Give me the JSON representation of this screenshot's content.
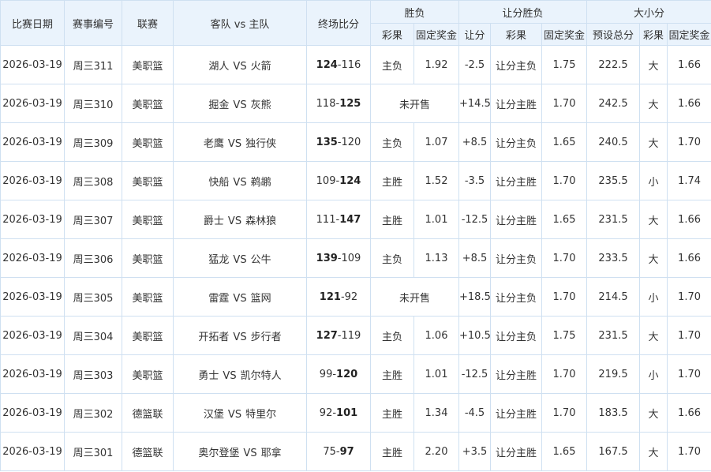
{
  "headers": {
    "date": "比赛日期",
    "match_no": "赛事编号",
    "league": "联赛",
    "teams": "客队 vs 主队",
    "final_score": "终场比分",
    "win_loss": "胜负",
    "handicap_win_loss": "让分胜负",
    "over_under": "大小分",
    "lottery_result": "彩果",
    "fixed_odds": "固定奖金",
    "handicap": "让分",
    "preset_total": "预设总分"
  },
  "vs_text": "VS",
  "rows": [
    {
      "date": "2026-03-19",
      "no": "周三311",
      "league": "美职篮",
      "away": "湖人",
      "home": "火箭",
      "away_score": "124",
      "home_score": "116",
      "winner": "away",
      "wl_result": "主负",
      "wl_odds": "1.92",
      "hc_line": "-2.5",
      "hc_result": "让分主负",
      "hc_odds": "1.75",
      "ou_total": "222.5",
      "ou_result": "大",
      "ou_odds": "1.66"
    },
    {
      "date": "2026-03-19",
      "no": "周三310",
      "league": "美职篮",
      "away": "掘金",
      "home": "灰熊",
      "away_score": "118",
      "home_score": "125",
      "winner": "home",
      "wl_merged": "未开售",
      "hc_line": "+14.5",
      "hc_result": "让分主胜",
      "hc_odds": "1.70",
      "ou_total": "242.5",
      "ou_result": "大",
      "ou_odds": "1.66"
    },
    {
      "date": "2026-03-19",
      "no": "周三309",
      "league": "美职篮",
      "away": "老鹰",
      "home": "独行侠",
      "away_score": "135",
      "home_score": "120",
      "winner": "away",
      "wl_result": "主负",
      "wl_odds": "1.07",
      "hc_line": "+8.5",
      "hc_result": "让分主负",
      "hc_odds": "1.65",
      "ou_total": "240.5",
      "ou_result": "大",
      "ou_odds": "1.70"
    },
    {
      "date": "2026-03-19",
      "no": "周三308",
      "league": "美职篮",
      "away": "快船",
      "home": "鹈鹕",
      "away_score": "109",
      "home_score": "124",
      "winner": "home",
      "wl_result": "主胜",
      "wl_odds": "1.52",
      "hc_line": "-3.5",
      "hc_result": "让分主胜",
      "hc_odds": "1.70",
      "ou_total": "235.5",
      "ou_result": "小",
      "ou_odds": "1.74"
    },
    {
      "date": "2026-03-19",
      "no": "周三307",
      "league": "美职篮",
      "away": "爵士",
      "home": "森林狼",
      "away_score": "111",
      "home_score": "147",
      "winner": "home",
      "wl_result": "主胜",
      "wl_odds": "1.01",
      "hc_line": "-12.5",
      "hc_result": "让分主胜",
      "hc_odds": "1.65",
      "ou_total": "231.5",
      "ou_result": "大",
      "ou_odds": "1.66"
    },
    {
      "date": "2026-03-19",
      "no": "周三306",
      "league": "美职篮",
      "away": "猛龙",
      "home": "公牛",
      "away_score": "139",
      "home_score": "109",
      "winner": "away",
      "wl_result": "主负",
      "wl_odds": "1.13",
      "hc_line": "+8.5",
      "hc_result": "让分主负",
      "hc_odds": "1.70",
      "ou_total": "233.5",
      "ou_result": "大",
      "ou_odds": "1.66"
    },
    {
      "date": "2026-03-19",
      "no": "周三305",
      "league": "美职篮",
      "away": "雷霆",
      "home": "篮网",
      "away_score": "121",
      "home_score": "92",
      "winner": "away",
      "wl_merged": "未开售",
      "hc_line": "+18.5",
      "hc_result": "让分主负",
      "hc_odds": "1.70",
      "ou_total": "214.5",
      "ou_result": "小",
      "ou_odds": "1.70"
    },
    {
      "date": "2026-03-19",
      "no": "周三304",
      "league": "美职篮",
      "away": "开拓者",
      "home": "步行者",
      "away_score": "127",
      "home_score": "119",
      "winner": "away",
      "wl_result": "主负",
      "wl_odds": "1.06",
      "hc_line": "+10.5",
      "hc_result": "让分主负",
      "hc_odds": "1.75",
      "ou_total": "231.5",
      "ou_result": "大",
      "ou_odds": "1.70"
    },
    {
      "date": "2026-03-19",
      "no": "周三303",
      "league": "美职篮",
      "away": "勇士",
      "home": "凯尔特人",
      "away_score": "99",
      "home_score": "120",
      "winner": "home",
      "wl_result": "主胜",
      "wl_odds": "1.01",
      "hc_line": "-12.5",
      "hc_result": "让分主胜",
      "hc_odds": "1.70",
      "ou_total": "219.5",
      "ou_result": "小",
      "ou_odds": "1.70"
    },
    {
      "date": "2026-03-19",
      "no": "周三302",
      "league": "德篮联",
      "away": "汉堡",
      "home": "特里尔",
      "away_score": "92",
      "home_score": "101",
      "winner": "home",
      "wl_result": "主胜",
      "wl_odds": "1.34",
      "hc_line": "-4.5",
      "hc_result": "让分主胜",
      "hc_odds": "1.70",
      "ou_total": "183.5",
      "ou_result": "大",
      "ou_odds": "1.66"
    },
    {
      "date": "2026-03-19",
      "no": "周三301",
      "league": "德篮联",
      "away": "奥尔登堡",
      "home": "耶拿",
      "away_score": "75",
      "home_score": "97",
      "winner": "home",
      "wl_result": "主胜",
      "wl_odds": "2.20",
      "hc_line": "+3.5",
      "hc_result": "让分主胜",
      "hc_odds": "1.65",
      "ou_total": "167.5",
      "ou_result": "大",
      "ou_odds": "1.70"
    }
  ]
}
